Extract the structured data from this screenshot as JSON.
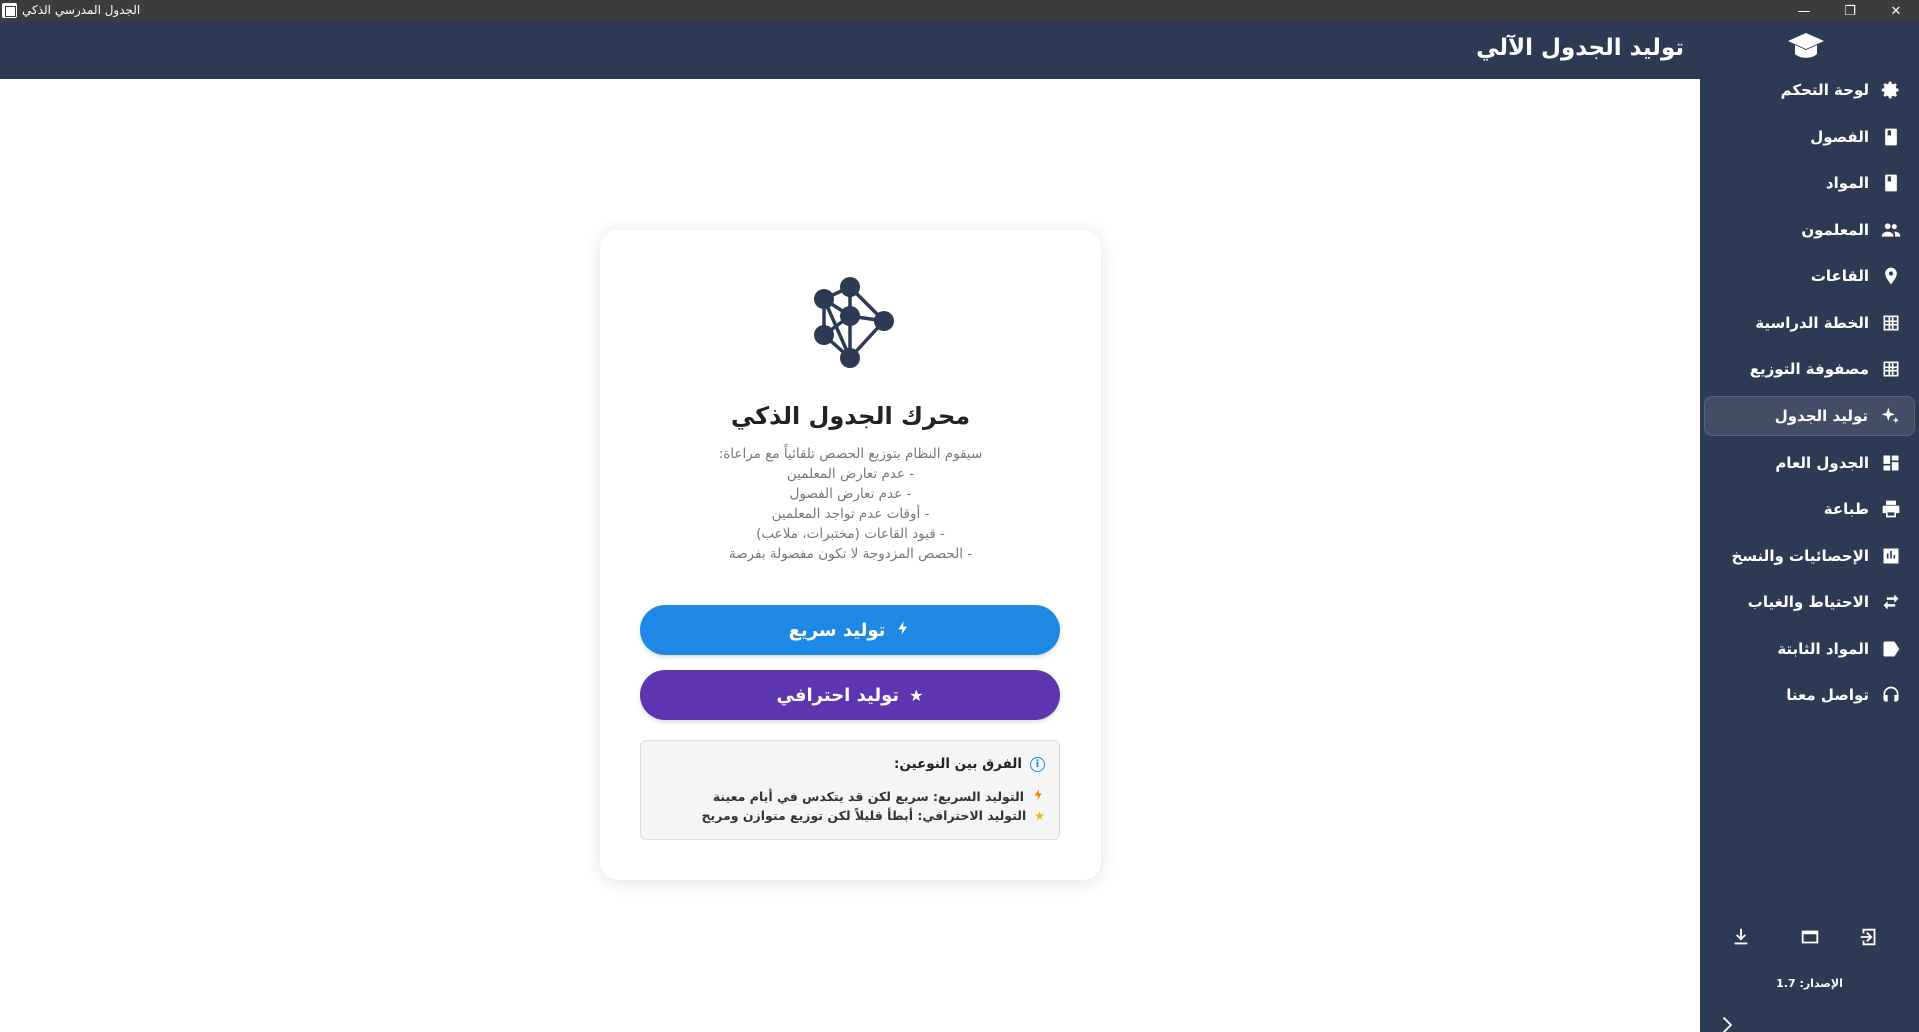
{
  "window": {
    "title": "الجدول المدرسي الذكي",
    "controls": [
      "—",
      "❐",
      "✕"
    ]
  },
  "header": {
    "title": "توليد الجدول الآلي"
  },
  "sidebar": {
    "items": [
      {
        "label": "لوحة التحكم",
        "icon": "gear-icon",
        "active": false
      },
      {
        "label": "الفصول",
        "icon": "book-icon",
        "active": false
      },
      {
        "label": "المواد",
        "icon": "book-icon",
        "active": false
      },
      {
        "label": "المعلمون",
        "icon": "people-icon",
        "active": false
      },
      {
        "label": "القاعات",
        "icon": "location-pin-icon",
        "active": false
      },
      {
        "label": "الخطة الدراسية",
        "icon": "grid-icon",
        "active": false
      },
      {
        "label": "مصفوفة التوزيع",
        "icon": "grid-icon",
        "active": false
      },
      {
        "label": "توليد الجدول",
        "icon": "sparkle-icon",
        "active": true
      },
      {
        "label": "الجدول العام",
        "icon": "dashboard-icon",
        "active": false
      },
      {
        "label": "طباعة",
        "icon": "printer-icon",
        "active": false
      },
      {
        "label": "الإحصائيات والنسخ",
        "icon": "chart-icon",
        "active": false
      },
      {
        "label": "الاحتياط والغياب",
        "icon": "swap-icon",
        "active": false
      },
      {
        "label": "المواد الثابتة",
        "icon": "tag-icon",
        "active": false
      },
      {
        "label": "تواصل معنا",
        "icon": "headset-icon",
        "active": false
      }
    ],
    "version": "الإصدار: 1.7",
    "tools": [
      "download-icon",
      "window-icon",
      "login-icon"
    ]
  },
  "card": {
    "title": "محرك الجدول الذكي",
    "description": [
      "سيقوم النظام بتوزيع الحصص تلقائياً مع مراعاة:",
      "- عدم تعارض المعلمين",
      "- عدم تعارض الفصول",
      "- أوقات عدم تواجد المعلمين",
      "- قيود القاعات (مختبرات، ملاعب)",
      "- الحصص المزدوجة لا تكون مفصولة بفرصة"
    ],
    "fast_button": "توليد سريع",
    "pro_button": "توليد احترافي",
    "info_title": "الفرق بين النوعين:",
    "info_fast": "التوليد السريع: سريع لكن قد يتكدس في أيام معينة",
    "info_pro": "التوليد الاحترافي: أبطأ قليلاً لكن توزيع متوازن ومريح"
  },
  "colors": {
    "sidebar_bg": "#2d3a53",
    "fast_button": "#1e88e5",
    "pro_button": "#5e35b1"
  }
}
